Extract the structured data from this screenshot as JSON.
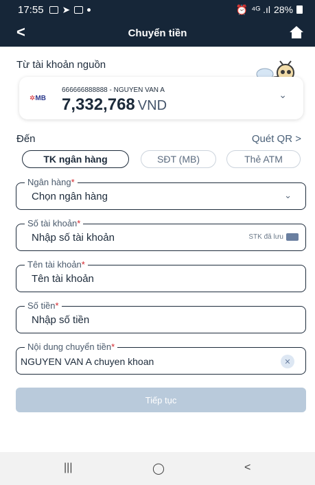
{
  "status_bar": {
    "time": "17:55",
    "signal_text": "⁴ᴳ .ıl",
    "battery": "28%"
  },
  "header": {
    "back_icon": "back-chevron-icon",
    "title": "Chuyển tiền",
    "home_icon": "home-icon"
  },
  "source": {
    "label": "Từ tài khoản nguồn",
    "bank_logo": "MB",
    "account_line": "666666888888 - NGUYEN VAN A",
    "balance": "7,332,768",
    "currency": "VND"
  },
  "destination": {
    "label": "Đến",
    "qr_link": "Quét QR >",
    "tabs": [
      {
        "label": "TK ngân hàng",
        "active": true
      },
      {
        "label": "SĐT (MB)",
        "active": false
      },
      {
        "label": "Thẻ ATM",
        "active": false
      }
    ]
  },
  "fields": {
    "bank": {
      "legend": "Ngân hàng",
      "value": "Chọn ngân hàng"
    },
    "account_number": {
      "legend": "Số tài khoản",
      "value": "Nhập số tài khoản",
      "saved_label": "STK đã lưu"
    },
    "account_name": {
      "legend": "Tên tài khoản",
      "value": "Tên tài khoản"
    },
    "amount": {
      "legend": "Số tiền",
      "value": "Nhập số tiền"
    },
    "content": {
      "legend": "Nội dung chuyển tiền",
      "value": "NGUYEN VAN A chuyen khoan"
    },
    "required_mark": "*"
  },
  "submit_label": "Tiếp tục",
  "navbar": {
    "recent": "|||",
    "home": "◯",
    "back": "<"
  },
  "colors": {
    "header_bg": "#162638",
    "accent_text": "#1c2a3a",
    "required": "#d2232a",
    "button_disabled": "#b9cadb"
  }
}
